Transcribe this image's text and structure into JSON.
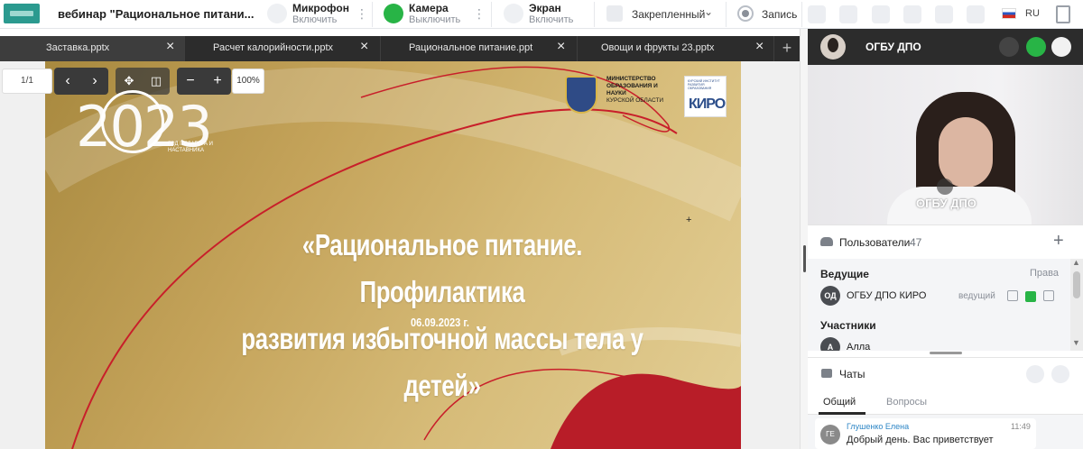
{
  "window": {
    "title": "вебинар \"Рациональное питани..."
  },
  "controls": {
    "microphone": {
      "label": "Микрофон",
      "action": "Включить"
    },
    "camera": {
      "label": "Камера",
      "action": "Выключить"
    },
    "screen": {
      "label": "Экран",
      "action": "Включить"
    },
    "pinned": "Закрепленный",
    "record": "Запись",
    "language": "RU"
  },
  "tabs": [
    {
      "label": "Заставка.pptx",
      "active": true
    },
    {
      "label": "Расчет калорийности.pptx",
      "active": false
    },
    {
      "label": "Рациональное питание.ppt",
      "active": false
    },
    {
      "label": "Овощи и фрукты 23.pptx",
      "active": false
    }
  ],
  "viewer": {
    "page": "1/1",
    "zoom": "100%"
  },
  "slide": {
    "year": "2023",
    "year_caption": "ГОД ПЕДАГОГА И НАСТАВНИКА",
    "ministry_bold": "МИНИСТЕРСТВО ОБРАЗОВАНИЯ И НАУКИ",
    "ministry_region": "КУРСКОЙ ОБЛАСТИ",
    "kiro_small": "КУРСКИЙ ИНСТИТУТ РАЗВИТИЯ ОБРАЗОВАНИЯ",
    "kiro_logo": "КИРО",
    "headline_line1": "«Рациональное питание. Профилактика",
    "headline_line2": "развития избыточной массы тела у детей»",
    "date": "06.09.2023 г."
  },
  "video": {
    "header_name": "ОГБУ ДПО",
    "label": "ОГБУ ДПО"
  },
  "users": {
    "title": "Пользователи",
    "count": "47",
    "presenters_label": "Ведущие",
    "rights_label": "Права",
    "presenter": {
      "initials": "ОД",
      "name": "ОГБУ ДПО КИРО",
      "role": "ведущий"
    },
    "participants_label": "Участники",
    "participant": {
      "initials": "А",
      "name": "Алла"
    }
  },
  "chats": {
    "title": "Чаты",
    "tab_general": "Общий",
    "tab_questions": "Вопросы",
    "message": {
      "initials": "ГЕ",
      "author": "Глушенко Елена",
      "time": "11:49",
      "text": "Добрый день. Вас приветствует"
    }
  },
  "colors": {
    "accent_green": "#28b446",
    "dark_header": "#2c2c2c",
    "slide_gold": "#c4a35a",
    "ribbon_red": "#c81f2a"
  }
}
